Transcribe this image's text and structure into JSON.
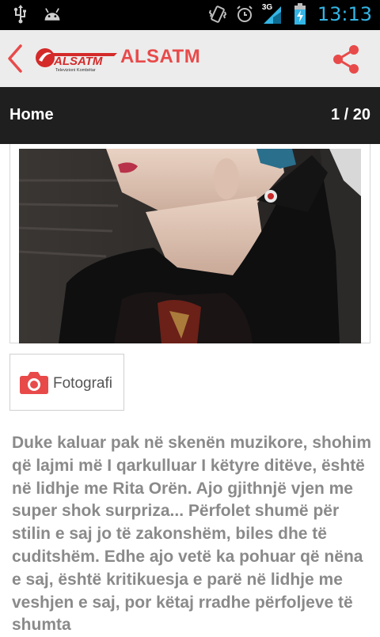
{
  "status_bar": {
    "time": "13:13",
    "network_label": "3G",
    "icons": [
      "usb-icon",
      "android-icon",
      "vibrate-icon",
      "alarm-clock-icon",
      "signal-icon",
      "battery-charging-icon"
    ]
  },
  "app_bar": {
    "title": "ALSATM",
    "logo_text": "ALSATM",
    "logo_subtext": "Televizioni Kombëtar",
    "back_icon": "chevron-left-icon",
    "share_icon": "share-icon",
    "accent_color": "#e84a4a"
  },
  "nav": {
    "section": "Home",
    "counter": "1 / 20"
  },
  "gallery_button": {
    "label": "Fotografi",
    "icon": "camera-icon"
  },
  "article": {
    "body": "Duke kaluar pak në skenën muzikore, shohim që lajmi më I qarkulluar I këtyre ditëve, është në lidhje me Rita Orën. Ajo gjithnjë vjen me super shok surpriza... Përfolet shumë për stilin e saj jo të zakonshëm, biles dhe të cuditshëm. Edhe ajo vetë ka pohuar që nëna e saj, është kritikuesja e parë në lidhje me veshjen e saj, por këtaj rradhe përfoljeve të shumta"
  }
}
